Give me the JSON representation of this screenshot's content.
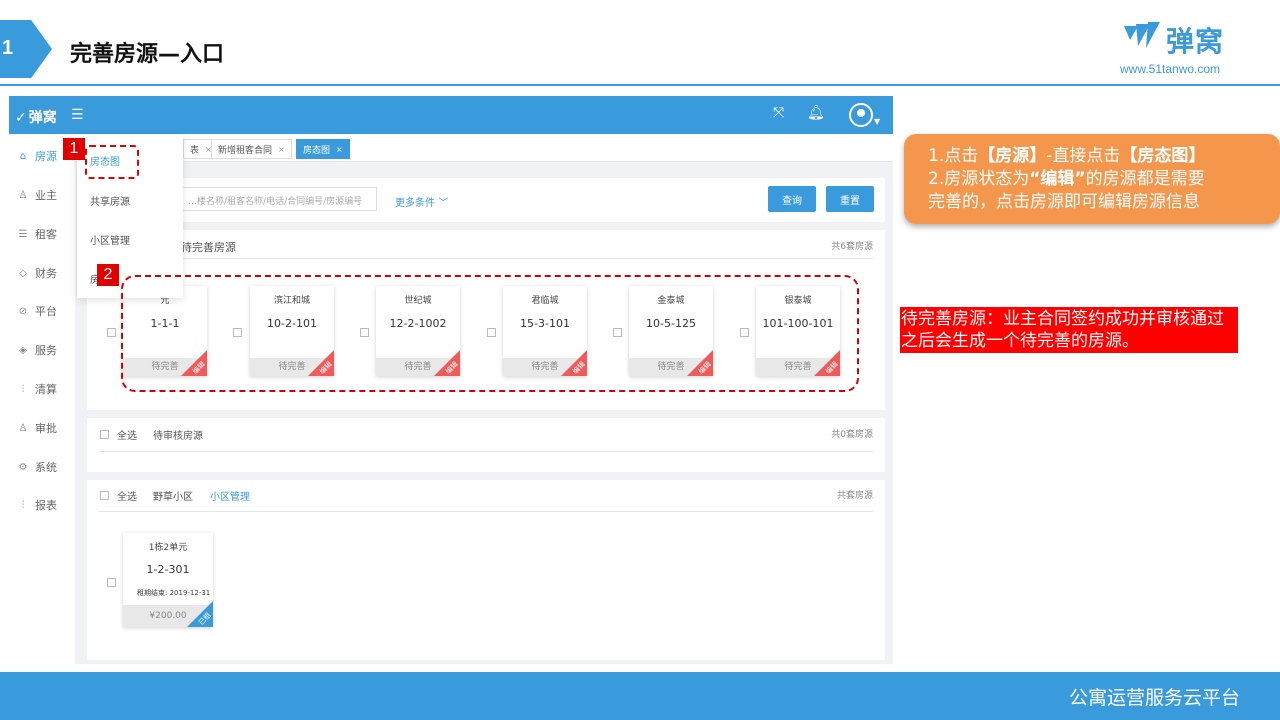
{
  "slide": {
    "number": "1",
    "title": "完善房源—入口",
    "brand_name": "弹窝",
    "brand_url": "www.51tanwo.com",
    "footer": "公寓运营服务云平台"
  },
  "app": {
    "logo_text": "弹窝",
    "sidebar": [
      "房源",
      "业主",
      "租客",
      "财务",
      "平台",
      "服务",
      "清算",
      "审批",
      "系统",
      "报表"
    ],
    "submenu": [
      "房态图",
      "共享房源",
      "小区管理",
      "房源"
    ],
    "tabs": [
      "表",
      "新增租客合同",
      "房态图"
    ],
    "search_placeholder": "…楼名称/租客名称/电话/合同编号/房源编号",
    "more_conditions": "更多条件",
    "query_button": "查询",
    "reset_button": "重置",
    "section1": {
      "label": "待完善房源",
      "count": "共6套房源"
    },
    "cards1": [
      {
        "name": "元",
        "room": "1-1-1",
        "status": "待完善",
        "tag": "编辑"
      },
      {
        "name": "滨江和城",
        "room": "10-2-101",
        "status": "待完善",
        "tag": "编辑"
      },
      {
        "name": "世纪城",
        "room": "12-2-1002",
        "status": "待完善",
        "tag": "编辑"
      },
      {
        "name": "君临城",
        "room": "15-3-101",
        "status": "待完善",
        "tag": "编辑"
      },
      {
        "name": "金泰城",
        "room": "10-5-125",
        "status": "待完善",
        "tag": "编辑"
      },
      {
        "name": "银泰城",
        "room": "101-100-101",
        "status": "待完善",
        "tag": "编辑"
      }
    ],
    "section2": {
      "select_all": "全选",
      "label": "待审核房源",
      "count": "共0套房源"
    },
    "section3": {
      "select_all": "全选",
      "label": "野草小区",
      "link": "小区管理",
      "count": "共套房源"
    },
    "card3": {
      "name": "1栋2单元",
      "room": "1-2-301",
      "lease": "租期结束: 2019-12-31",
      "price": "¥200.00",
      "tag": "已租"
    }
  },
  "annotations": {
    "marker1": "1",
    "marker2": "2",
    "callout_line1_pre": "1.点击",
    "callout_line1_b1": "【房源】",
    "callout_line1_mid": "-直接点击",
    "callout_line1_b2": "【房态图】",
    "callout_line2_pre": "2.房源状态为",
    "callout_line2_b": "“编辑”",
    "callout_line2_post": "的房源都是需要",
    "callout_line3": "完善的，点击房源即可编辑房源信息",
    "note": "待完善房源：业主合同签约成功并审核通过之后会生成一个待完善的房源。"
  }
}
